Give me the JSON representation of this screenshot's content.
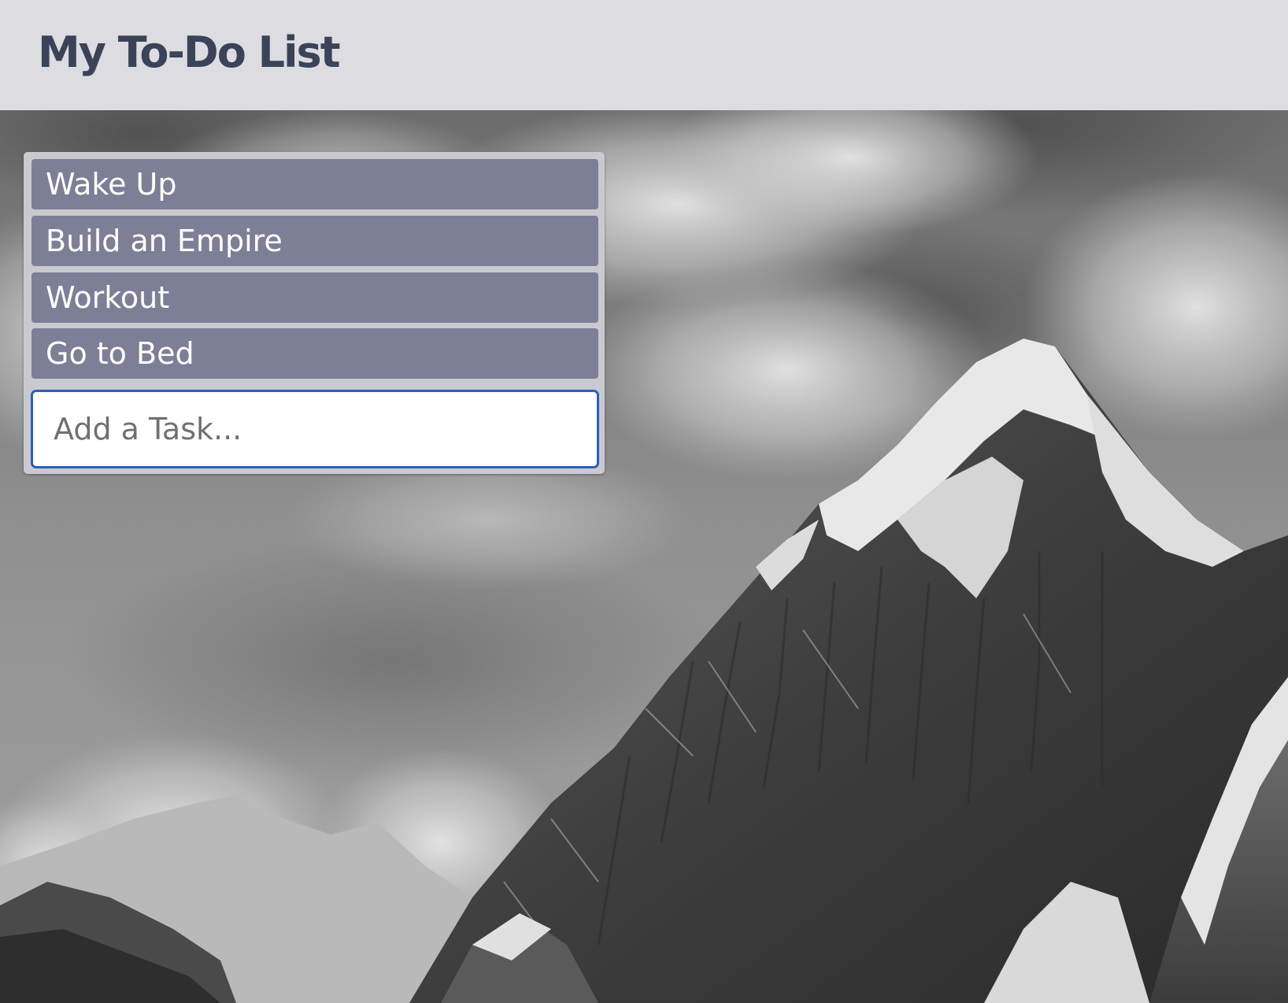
{
  "header": {
    "title": "My To-Do List"
  },
  "tasks": [
    {
      "label": "Wake Up"
    },
    {
      "label": "Build an Empire"
    },
    {
      "label": "Workout"
    },
    {
      "label": "Go to Bed"
    }
  ],
  "new_task": {
    "value": "",
    "placeholder": "Add a Task..."
  },
  "colors": {
    "header_bg": "#dcdce1",
    "title_text": "#3a4358",
    "task_bg": "#7c7f95",
    "task_text": "#ffffff",
    "panel_bg": "#c9c9cf",
    "input_border": "#2a5fba"
  },
  "background_image": "grayscale-snowy-mountain-peak-with-clouds"
}
